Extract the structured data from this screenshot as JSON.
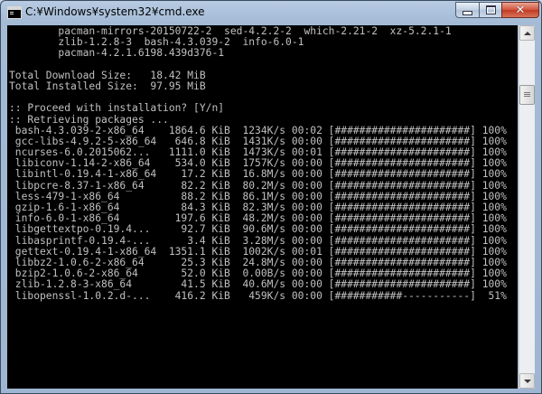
{
  "window": {
    "title": "C:¥Windows¥system32¥cmd.exe",
    "icon": "console-icon",
    "controls": {
      "minimize_icon": "minimize-icon",
      "maximize_icon": "maximize-icon",
      "close_icon": "close-icon",
      "close_glyph": "✕"
    }
  },
  "console": {
    "foreground": "#c0c0c0",
    "background": "#000000",
    "lines": [
      "        pacman-mirrors-20150722-2  sed-4.2.2-2  which-2.21-2  xz-5.2.1-1",
      "        zlib-1.2.8-3  bash-4.3.039-2  info-6.0-1",
      "        pacman-4.2.1.6198.439d376-1",
      "",
      "Total Download Size:   18.42 MiB",
      "Total Installed Size:  97.95 MiB",
      "",
      ":: Proceed with installation? [Y/n]",
      ":: Retrieving packages ...",
      " bash-4.3.039-2-x86_64    1864.6 KiB  1234K/s 00:02 [######################] 100%",
      " gcc-libs-4.9.2-5-x86_64   646.8 KiB  1431K/s 00:00 [######################] 100%",
      " ncurses-6.0.2015062...   1111.0 KiB  1473K/s 00:01 [######################] 100%",
      " libiconv-1.14-2-x86_64    534.0 KiB  1757K/s 00:00 [######################] 100%",
      " libintl-0.19.4-1-x86_64    17.2 KiB  16.8M/s 00:00 [######################] 100%",
      " libpcre-8.37-1-x86_64      82.2 KiB  80.2M/s 00:00 [######################] 100%",
      " less-479-1-x86_64          88.2 KiB  86.1M/s 00:00 [######################] 100%",
      " gzip-1.6-1-x86_64          84.3 KiB  82.3M/s 00:00 [######################] 100%",
      " info-6.0-1-x86_64         197.6 KiB  48.2M/s 00:00 [######################] 100%",
      " libgettextpo-0.19.4...     92.7 KiB  90.6M/s 00:00 [######################] 100%",
      " libasprintf-0.19.4-...      3.4 KiB  3.28M/s 00:00 [######################] 100%",
      " gettext-0.19.4-1-x86_64  1351.1 KiB  1002K/s 00:01 [######################] 100%",
      " libbz2-1.0.6-2-x86_64      25.3 KiB  24.8M/s 00:00 [######################] 100%",
      " bzip2-1.0.6-2-x86_64       52.0 KiB  0.00B/s 00:00 [######################] 100%",
      " zlib-1.2.8-3-x86_64        41.5 KiB  40.6M/s 00:00 [######################] 100%",
      " libopenssl-1.0.2.d-...    416.2 KiB   459K/s 00:00 [###########-----------]  51%"
    ]
  },
  "scrollbar": {
    "up_icon": "scroll-up-arrow-icon",
    "down_icon": "scroll-down-arrow-icon",
    "thumb_icon": "scroll-thumb-grip-icon"
  }
}
